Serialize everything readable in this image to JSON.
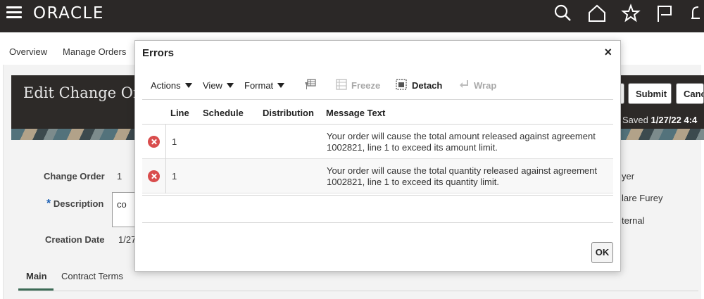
{
  "app": {
    "logo": "ORACLE"
  },
  "topbar": {
    "icons": [
      "search-icon",
      "home-icon",
      "favorites-star-icon",
      "watchlist-flag-icon",
      "notifications-bell-icon"
    ]
  },
  "nav": {
    "items": [
      "Overview",
      "Manage Orders"
    ]
  },
  "page": {
    "title": "Edit Change Order",
    "buttons": {
      "submit": "Submit",
      "cancel": "Cancel"
    },
    "saved_label": "Saved",
    "saved_date": "1/27/22 4:4"
  },
  "form": {
    "change_order_label": "Change Order",
    "change_order_value": "1",
    "required_marker": "*",
    "description_label": "Description",
    "description_value": "co",
    "creation_date_label": "Creation Date",
    "creation_date_value": "1/27",
    "right_values": [
      "yer",
      "lare Furey",
      "ternal"
    ]
  },
  "tabs": [
    {
      "label": "Main",
      "active": true
    },
    {
      "label": "Contract Terms",
      "active": false
    }
  ],
  "dialog": {
    "title": "Errors",
    "close": "×",
    "toolbar": {
      "actions": "Actions",
      "view": "View",
      "format": "Format",
      "freeze": "Freeze",
      "detach": "Detach",
      "wrap": "Wrap"
    },
    "columns": [
      "Line",
      "Schedule",
      "Distribution",
      "Message Text"
    ],
    "rows": [
      {
        "line": "1",
        "schedule": "",
        "distribution": "",
        "message": "Your order will cause the total amount released against agreement 1002821, line 1 to exceed its amount limit."
      },
      {
        "line": "1",
        "schedule": "",
        "distribution": "",
        "message": "Your order will cause the total quantity released against agreement 1002821, line 1 to exceed its quantity limit."
      }
    ],
    "ok": "OK"
  },
  "colors": {
    "topbar": "#2b2827",
    "error": "#d94d4d",
    "required": "#1a5fb4"
  }
}
